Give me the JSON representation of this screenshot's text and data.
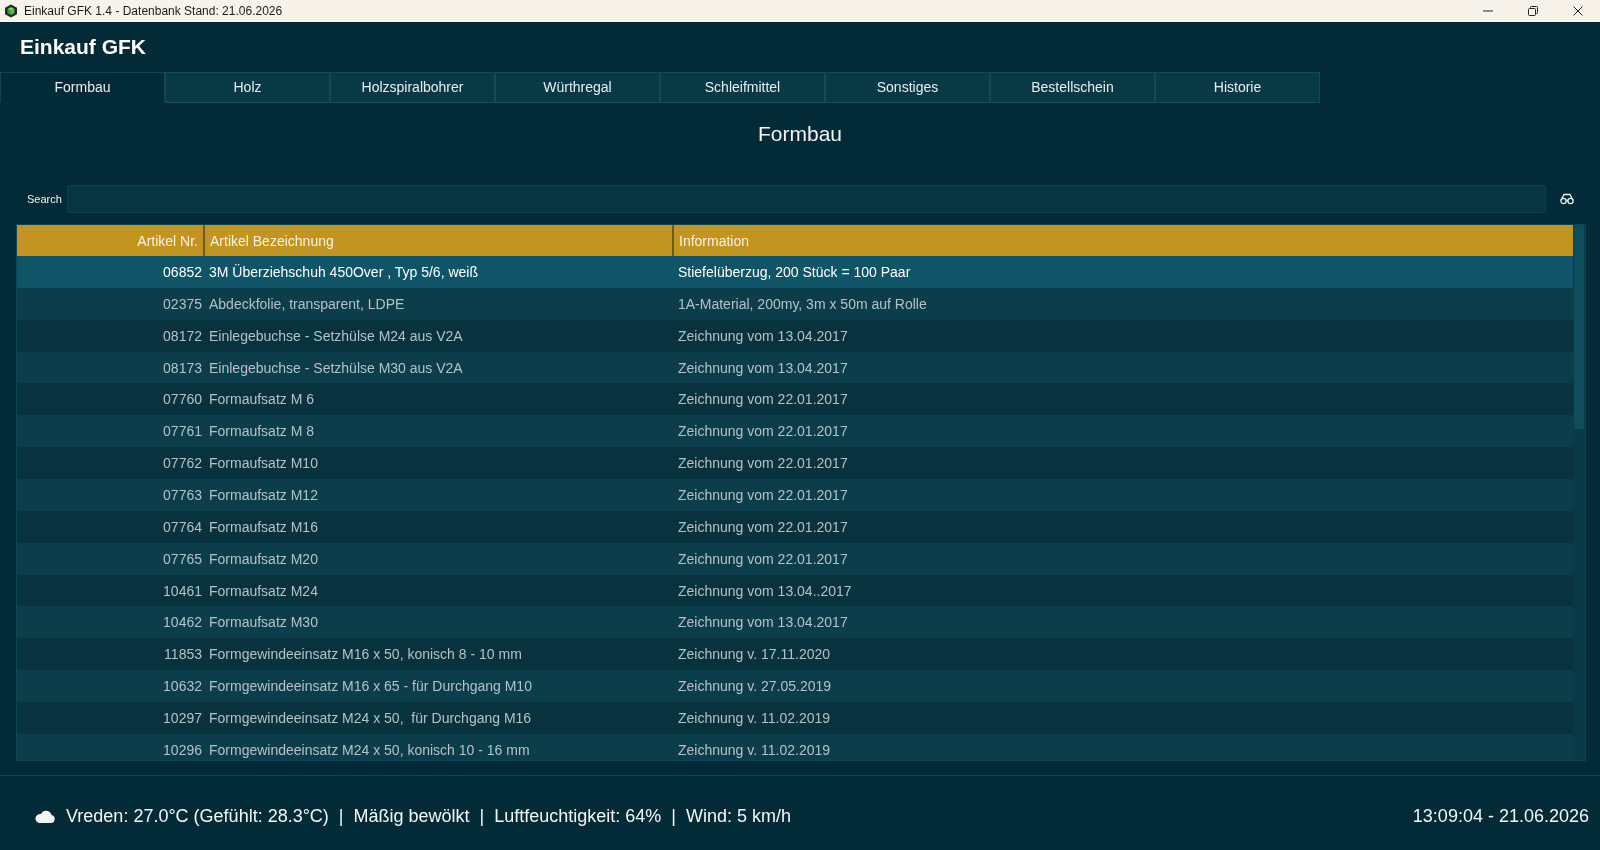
{
  "window": {
    "title": "Einkauf GFK 1.4 - Datenbank Stand: 21.06.2026"
  },
  "app_title": "Einkauf GFK",
  "tabs": [
    {
      "label": "Formbau",
      "selected": true
    },
    {
      "label": "Holz",
      "selected": false
    },
    {
      "label": "Holzspiralbohrer",
      "selected": false
    },
    {
      "label": "Würthregal",
      "selected": false
    },
    {
      "label": "Schleifmittel",
      "selected": false
    },
    {
      "label": "Sonstiges",
      "selected": false
    },
    {
      "label": "Bestellschein",
      "selected": false
    },
    {
      "label": "Historie",
      "selected": false
    }
  ],
  "page_title": "Formbau",
  "search": {
    "label": "Search"
  },
  "table": {
    "columns": [
      "Artikel Nr.",
      "Artikel Bezeichnung",
      "Information"
    ],
    "rows": [
      {
        "cells": [
          "06852",
          "3M Überziehschuh 450Over , Typ 5/6, weiß",
          "Stiefelüberzug, 200 Stück = 100 Paar"
        ],
        "selected": true
      },
      {
        "cells": [
          "02375",
          "Abdeckfolie, transparent, LDPE",
          "1A-Material, 200my, 3m x 50m auf Rolle"
        ],
        "selected": false
      },
      {
        "cells": [
          "08172",
          "Einlegebuchse - Setzhülse M24 aus V2A",
          "Zeichnung vom 13.04.2017"
        ],
        "selected": false
      },
      {
        "cells": [
          "08173",
          "Einlegebuchse - Setzhülse M30 aus V2A",
          "Zeichnung vom 13.04.2017"
        ],
        "selected": false
      },
      {
        "cells": [
          "07760",
          "Formaufsatz M 6",
          "Zeichnung vom 22.01.2017"
        ],
        "selected": false
      },
      {
        "cells": [
          "07761",
          "Formaufsatz M 8",
          "Zeichnung vom 22.01.2017"
        ],
        "selected": false
      },
      {
        "cells": [
          "07762",
          "Formaufsatz M10",
          "Zeichnung vom 22.01.2017"
        ],
        "selected": false
      },
      {
        "cells": [
          "07763",
          "Formaufsatz M12",
          "Zeichnung vom 22.01.2017"
        ],
        "selected": false
      },
      {
        "cells": [
          "07764",
          "Formaufsatz M16",
          "Zeichnung vom 22.01.2017"
        ],
        "selected": false
      },
      {
        "cells": [
          "07765",
          "Formaufsatz M20",
          "Zeichnung vom 22.01.2017"
        ],
        "selected": false
      },
      {
        "cells": [
          "10461",
          "Formaufsatz M24",
          "Zeichnung vom 13.04..2017"
        ],
        "selected": false
      },
      {
        "cells": [
          "10462",
          "Formaufsatz M30",
          "Zeichnung vom 13.04.2017"
        ],
        "selected": false
      },
      {
        "cells": [
          "11853",
          "Formgewindeeinsatz M16 x 50, konisch 8 - 10 mm",
          "Zeichnung v. 17.11.2020"
        ],
        "selected": false
      },
      {
        "cells": [
          "10632",
          "Formgewindeeinsatz M16 x 65 - für Durchgang M10",
          "Zeichnung v. 27.05.2019"
        ],
        "selected": false
      },
      {
        "cells": [
          "10297",
          "Formgewindeeinsatz M24 x 50,  für Durchgang M16",
          "Zeichnung v. 11.02.2019"
        ],
        "selected": false
      },
      {
        "cells": [
          "10296",
          "Formgewindeeinsatz M24 x 50, konisch 10 - 16 mm",
          "Zeichnung v. 11.02.2019"
        ],
        "selected": false
      }
    ]
  },
  "status_bar": {
    "weather": "Vreden: 27.0°C (Gefühlt: 28.3°C)  |  Mäßig bewölkt  |  Luftfeuchtigkeit: 64%  |  Wind: 5 km/h",
    "datetime": "13:09:04 - 21.06.2026"
  }
}
